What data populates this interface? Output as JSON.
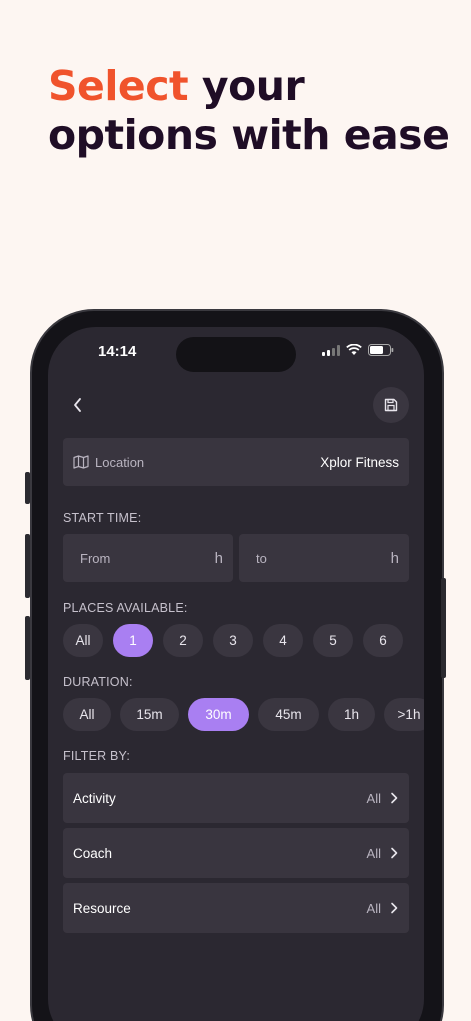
{
  "headline": {
    "accent": "Select",
    "rest_line1": " your",
    "line2": "options with ease"
  },
  "colors": {
    "accent": "#f0532c",
    "selected_chip": "#a97ff2",
    "screen_bg": "#2b2831"
  },
  "status_bar": {
    "time": "14:14"
  },
  "location": {
    "label": "Location",
    "value": "Xplor Fitness"
  },
  "start_time": {
    "label": "START TIME:",
    "from_placeholder": "From",
    "from_unit": "h",
    "to_placeholder": "to",
    "to_unit": "h"
  },
  "places": {
    "label": "PLACES AVAILABLE:",
    "options": [
      "All",
      "1",
      "2",
      "3",
      "4",
      "5",
      "6"
    ],
    "selected": "1"
  },
  "duration": {
    "label": "DURATION:",
    "options": [
      "All",
      "15m",
      "30m",
      "45m",
      "1h",
      ">1h"
    ],
    "selected": "30m"
  },
  "filter": {
    "label": "FILTER BY:",
    "rows": [
      {
        "name": "Activity",
        "value": "All"
      },
      {
        "name": "Coach",
        "value": "All"
      },
      {
        "name": "Resource",
        "value": "All"
      }
    ]
  }
}
